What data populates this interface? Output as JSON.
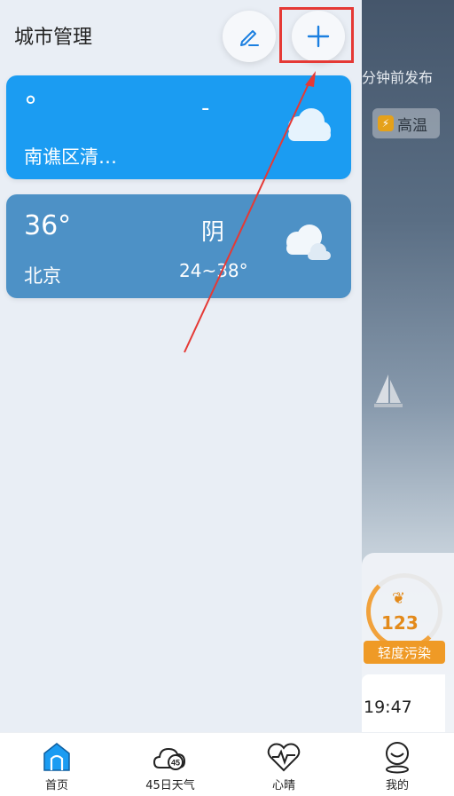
{
  "background": {
    "published_text": "分钟前发布",
    "alert_badge": "高温",
    "aqi_value": "123",
    "aqi_label": "轻度污染",
    "time_text": "19:47"
  },
  "drawer": {
    "title": "城市管理",
    "edit_icon": "pencil-icon",
    "add_icon": "plus-icon"
  },
  "cities": [
    {
      "temp": "°",
      "condition": "-",
      "name": "南谯区清…",
      "range": "",
      "icon": "cloud-icon"
    },
    {
      "temp": "36°",
      "condition": "阴",
      "name": "北京",
      "range": "24~38°",
      "icon": "cloudy-icon"
    }
  ],
  "nav": [
    {
      "label": "首页",
      "icon": "home-icon",
      "active": true
    },
    {
      "label": "45日天气",
      "icon": "cloud-45-icon"
    },
    {
      "label": "心晴",
      "icon": "heart-pulse-icon"
    },
    {
      "label": "我的",
      "icon": "profile-icon"
    }
  ],
  "colors": {
    "accent": "#1b9cf2",
    "highlight": "#e53935"
  }
}
